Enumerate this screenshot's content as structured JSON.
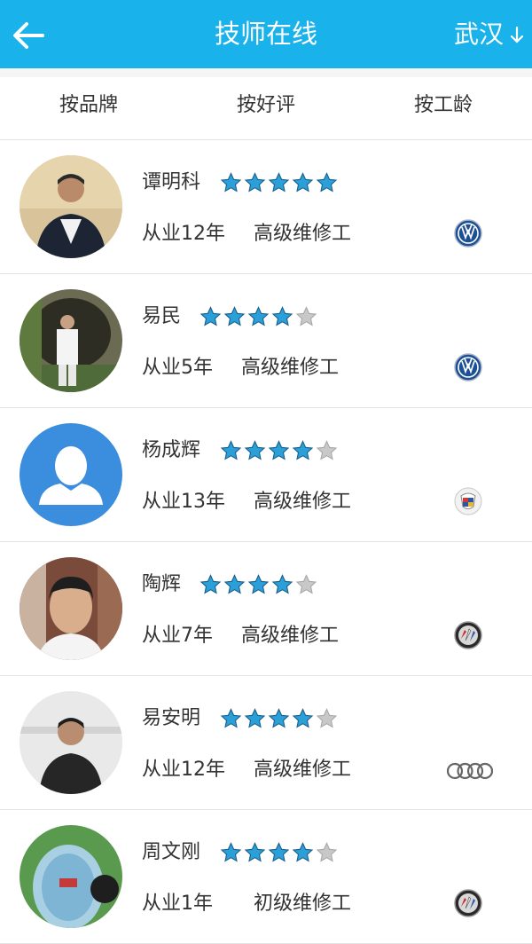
{
  "header": {
    "title": "技师在线",
    "city": "武汉",
    "back_icon": "back-arrow-icon",
    "city_arrow_icon": "down-arrow-icon",
    "color": "#1ab2ea"
  },
  "sort_bar": {
    "brand": "按品牌",
    "rating": "按好评",
    "seniority": "按工龄"
  },
  "technicians": [
    {
      "name": "谭明科",
      "stars": 5,
      "experience": "从业12年",
      "level": "高级维修工",
      "brand_icon": "volkswagen-logo-icon"
    },
    {
      "name": "易民",
      "stars": 4,
      "experience": "从业5年",
      "level": "高级维修工",
      "brand_icon": "volkswagen-logo-icon"
    },
    {
      "name": "杨成辉",
      "stars": 4,
      "experience": "从业13年",
      "level": "高级维修工",
      "brand_icon": "cadillac-logo-icon"
    },
    {
      "name": "陶辉",
      "stars": 4,
      "experience": "从业7年",
      "level": "高级维修工",
      "brand_icon": "buick-logo-icon"
    },
    {
      "name": "易安明",
      "stars": 4,
      "experience": "从业12年",
      "level": "高级维修工",
      "brand_icon": "audi-logo-icon"
    },
    {
      "name": "周文刚",
      "stars": 4,
      "experience": "从业1年",
      "level": "初级维修工",
      "brand_icon": "buick-logo-icon"
    }
  ],
  "colors": {
    "star_filled": "#2a9fd8",
    "star_empty": "#c8c8c8"
  }
}
